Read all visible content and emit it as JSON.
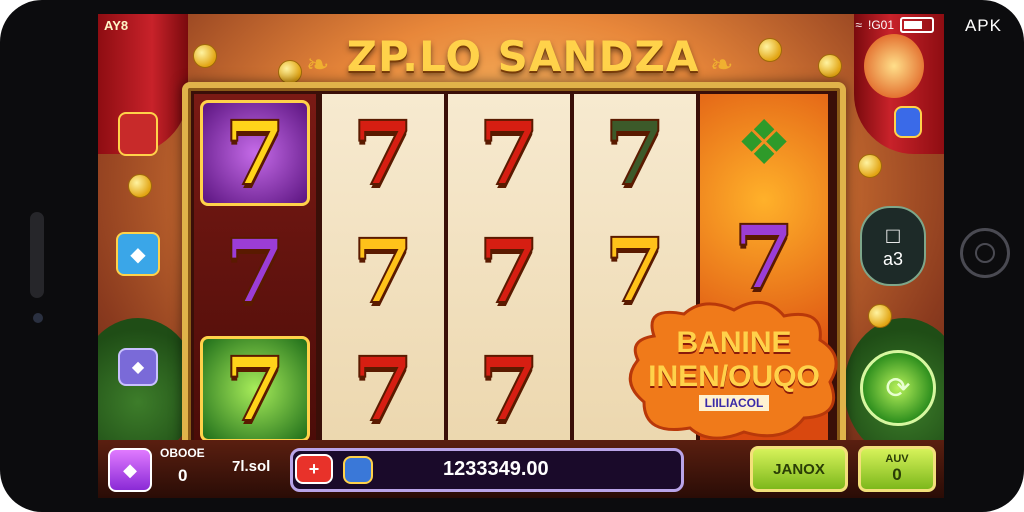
{
  "status": {
    "time": "AY8",
    "network": "!G01",
    "apk_label": "APK"
  },
  "game": {
    "title": "ZP.LO SANDZA"
  },
  "reels": [
    {
      "symbols": [
        "7",
        "7",
        "7"
      ],
      "colors": [
        "#ffd41a",
        "#9b3dd6",
        "#ffd41a"
      ]
    },
    {
      "symbols": [
        "7",
        "7",
        "7"
      ],
      "colors": [
        "#d61e12",
        "#ffc21a",
        "#d61e12"
      ]
    },
    {
      "symbols": [
        "7",
        "7",
        "7"
      ],
      "colors": [
        "#d61e12",
        "#d61e12",
        "#d61e12"
      ]
    },
    {
      "symbols": [
        "7",
        "7"
      ],
      "colors": [
        "#3c5a2a",
        "#ffc21a"
      ]
    },
    {
      "symbols": [
        "7"
      ],
      "colors": [
        "#9b3dd6"
      ]
    }
  ],
  "side": {
    "right_box_value": "a3"
  },
  "banner": {
    "line1": "BANINE",
    "line2": "INEN/OUQO",
    "line3": "LIILIACOL"
  },
  "bottom": {
    "left_label": "OBOOE",
    "left_value": "0",
    "mid_label": "7l.sol",
    "balance": "1233349.00",
    "spin_label": "JANOX",
    "auto_label": "AUV",
    "auto_value": "0"
  },
  "colors": {
    "accent_gold": "#ffd24a",
    "purple": "#9b3dd6",
    "green": "#7db81c"
  }
}
